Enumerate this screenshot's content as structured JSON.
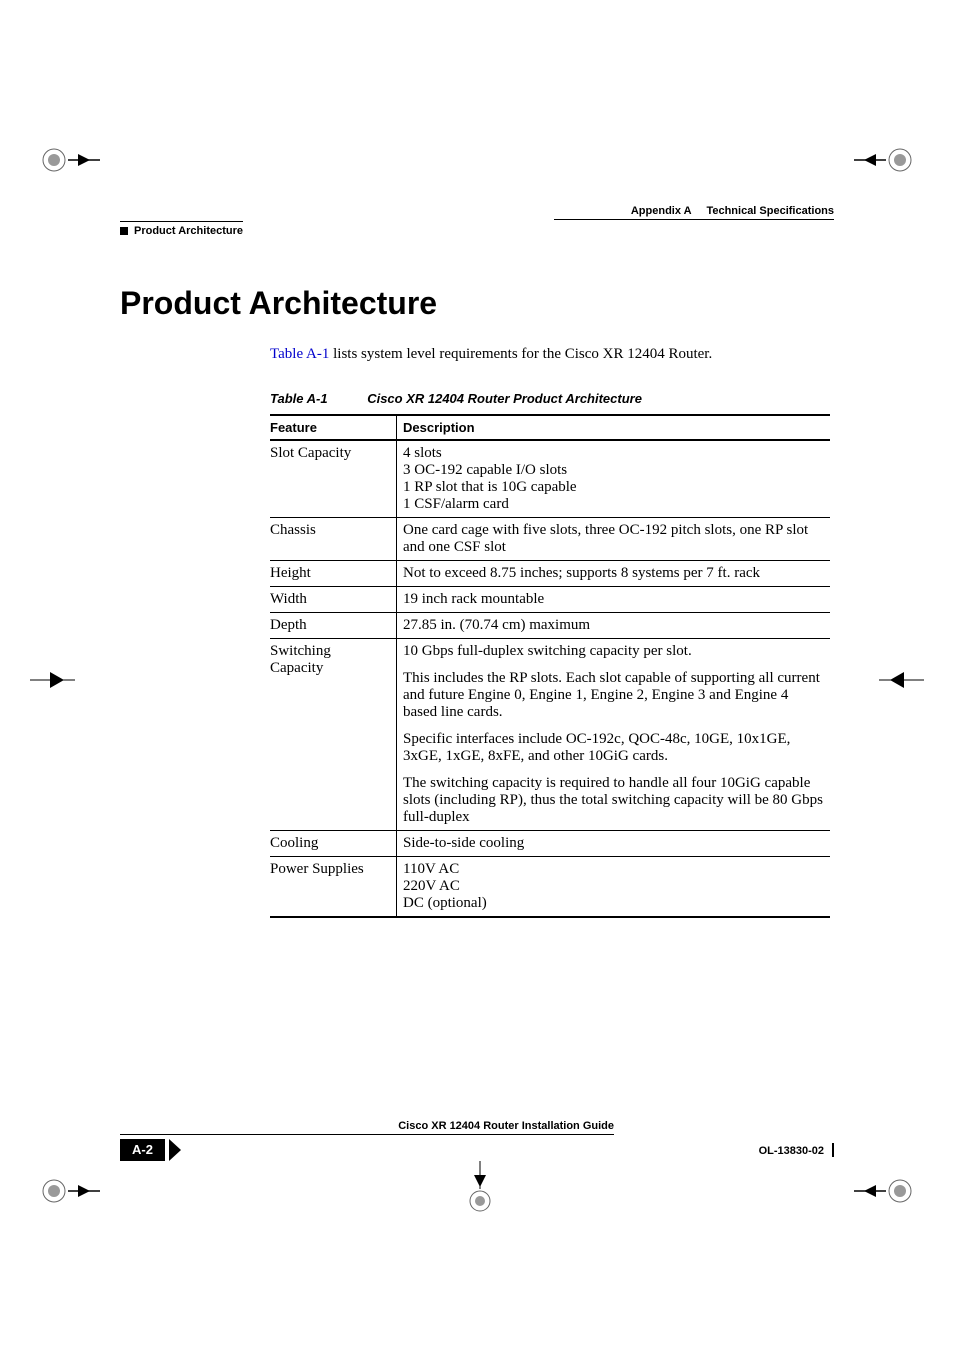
{
  "header": {
    "appendix_label": "Appendix A",
    "appendix_title": "Technical Specifications",
    "section_running": "Product Architecture"
  },
  "section": {
    "title": "Product Architecture",
    "intro_prefix": " lists system level requirements for the Cisco XR 12404 Router.",
    "intro_xref": "Table A-1"
  },
  "table": {
    "caption_number": "Table A-1",
    "caption_title": "Cisco XR 12404 Router Product Architecture",
    "headers": {
      "feature": "Feature",
      "description": "Description"
    },
    "rows": [
      {
        "feature": "Slot Capacity",
        "desc": [
          "4 slots",
          "3 OC-192 capable I/O slots",
          "1 RP slot that is 10G capable",
          "1 CSF/alarm card"
        ]
      },
      {
        "feature": "Chassis",
        "desc": [
          "One card cage with five slots, three OC-192 pitch slots, one RP slot and one CSF slot"
        ]
      },
      {
        "feature": "Height",
        "desc": [
          "Not to exceed 8.75 inches; supports 8 systems per 7 ft. rack"
        ]
      },
      {
        "feature": "Width",
        "desc": [
          "19 inch rack mountable"
        ]
      },
      {
        "feature": "Depth",
        "desc": [
          "27.85 in. (70.74 cm) maximum"
        ]
      },
      {
        "feature": "Switching Capacity",
        "desc": [
          "10 Gbps full-duplex switching capacity per slot.",
          "This includes the RP slots. Each slot capable of supporting all current and future Engine 0, Engine 1, Engine 2, Engine 3 and Engine 4 based line cards.",
          "Specific interfaces include OC-192c, QOC-48c, 10GE, 10x1GE, 3xGE, 1xGE, 8xFE, and other 10GiG cards.",
          "The switching capacity is required to handle all four 10GiG capable slots (including RP), thus the total switching capacity will be 80 Gbps full-duplex"
        ]
      },
      {
        "feature": "Cooling",
        "desc": [
          "Side-to-side cooling"
        ]
      },
      {
        "feature": "Power Supplies",
        "desc": [
          "110V AC",
          "220V AC",
          "DC (optional)"
        ]
      }
    ]
  },
  "footer": {
    "guide_title": "Cisco XR 12404 Router Installation Guide",
    "page_number": "A-2",
    "doc_id": "OL-13830-02"
  }
}
